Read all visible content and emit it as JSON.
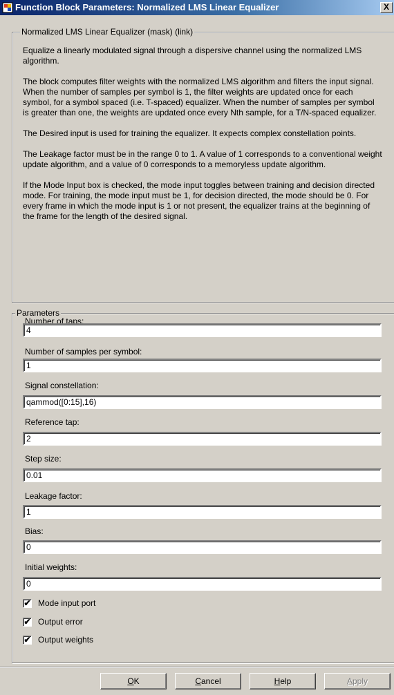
{
  "window": {
    "title": "Function Block Parameters: Normalized LMS  Linear Equalizer",
    "close_glyph": "X",
    "app_icon": "simulink-block-icon"
  },
  "mask_group": {
    "legend": "Normalized LMS Linear Equalizer (mask) (link)",
    "paragraphs": [
      "Equalize a linearly modulated signal through a dispersive channel using the normalized LMS algorithm.",
      "The block computes filter weights with the normalized LMS algorithm and filters the input signal. When the number of samples per symbol is 1, the filter weights are updated once for each symbol, for a symbol spaced (i.e. T-spaced) equalizer. When the number of samples per symbol is greater than one, the weights are updated once every Nth sample, for a T/N-spaced equalizer.",
      "The Desired input is used for training the equalizer. It expects complex constellation points.",
      "The Leakage factor must be in the range 0 to 1.  A value of 1 corresponds to a conventional weight update algorithm, and a value of 0 corresponds to a memoryless update algorithm.",
      "If the Mode Input box is checked, the mode input toggles between training and decision directed mode. For training, the mode input must be 1, for decision directed, the mode should be 0. For every frame in which the mode input is 1 or not present, the equalizer trains at the beginning of the frame for the length of the desired signal."
    ]
  },
  "parameters": {
    "legend": "Parameters",
    "fields": [
      {
        "label": "Number of taps:",
        "value": "4"
      },
      {
        "label": "Number of samples per symbol:",
        "value": "1"
      },
      {
        "label": "Signal constellation:",
        "value": "qammod([0:15],16)"
      },
      {
        "label": "Reference tap:",
        "value": "2"
      },
      {
        "label": "Step size:",
        "value": "0.01"
      },
      {
        "label": "Leakage factor:",
        "value": "1"
      },
      {
        "label": "Bias:",
        "value": "0"
      },
      {
        "label": "Initial weights:",
        "value": "0"
      }
    ],
    "checkboxes": [
      {
        "label": "Mode input port",
        "checked": true
      },
      {
        "label": "Output error",
        "checked": true
      },
      {
        "label": "Output weights",
        "checked": true
      }
    ]
  },
  "buttons": {
    "ok": {
      "prefix": "",
      "mnemonic": "O",
      "rest": "K"
    },
    "cancel": {
      "prefix": "",
      "mnemonic": "C",
      "rest": "ancel"
    },
    "help": {
      "prefix": "",
      "mnemonic": "H",
      "rest": "elp"
    },
    "apply": {
      "prefix": "",
      "mnemonic": "A",
      "rest": "pply"
    }
  },
  "check_glyph": "✔"
}
